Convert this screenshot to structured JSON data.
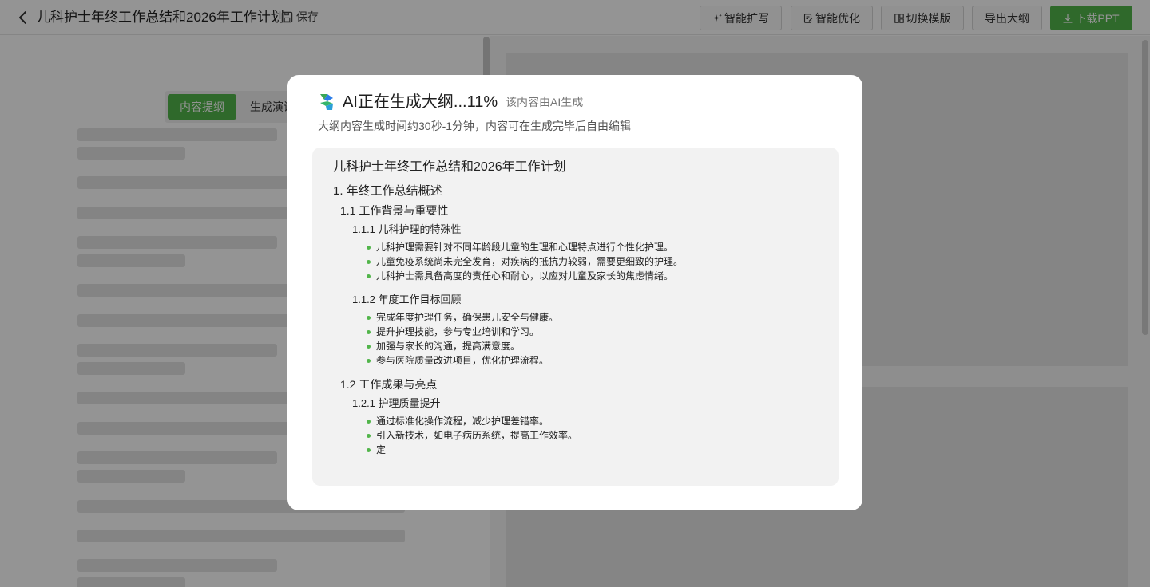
{
  "header": {
    "title": "儿科护士年终工作总结和2026年工作计划",
    "save_label": "保存",
    "buttons": {
      "expand": "智能扩写",
      "optimize": "智能优化",
      "switch_template": "切换模版",
      "export_outline": "导出大纲",
      "download_ppt": "下载PPT"
    }
  },
  "tabs": {
    "outline": "内容提纲",
    "speech": "生成演讲稿"
  },
  "modal": {
    "title": "AI正在生成大纲...11%",
    "ai_note": "该内容由AI生成",
    "subtitle": "大纲内容生成时间约30秒-1分钟，内容可在生成完毕后自由编辑",
    "progress_percent": 11
  },
  "outline": {
    "title": "儿科护士年终工作总结和2026年工作计划",
    "items": [
      {
        "level": 1,
        "text": "1. 年终工作总结概述"
      },
      {
        "level": 2,
        "text": "1.1 工作背景与重要性"
      },
      {
        "level": 3,
        "text": "1.1.1 儿科护理的特殊性"
      },
      {
        "level": 4,
        "text": "儿科护理需要针对不同年龄段儿童的生理和心理特点进行个性化护理。"
      },
      {
        "level": 4,
        "text": "儿童免疫系统尚未完全发育，对疾病的抵抗力较弱，需要更细致的护理。"
      },
      {
        "level": 4,
        "text": "儿科护士需具备高度的责任心和耐心，以应对儿童及家长的焦虑情绪。"
      },
      {
        "level": 3,
        "text": "1.1.2 年度工作目标回顾"
      },
      {
        "level": 4,
        "text": "完成年度护理任务，确保患儿安全与健康。"
      },
      {
        "level": 4,
        "text": "提升护理技能，参与专业培训和学习。"
      },
      {
        "level": 4,
        "text": "加强与家长的沟通，提高满意度。"
      },
      {
        "level": 4,
        "text": "参与医院质量改进项目，优化护理流程。"
      },
      {
        "level": 2,
        "text": "1.2 工作成果与亮点"
      },
      {
        "level": 3,
        "text": "1.2.1 护理质量提升"
      },
      {
        "level": 4,
        "text": "通过标准化操作流程，减少护理差错率。"
      },
      {
        "level": 4,
        "text": "引入新技术，如电子病历系统，提高工作效率。"
      },
      {
        "level": 4,
        "text": "定"
      }
    ]
  },
  "colors": {
    "accent": "#52b54b",
    "overlay": "rgba(0,0,0,0.42)"
  },
  "icons": [
    "back-arrow-icon",
    "save-icon",
    "sparkle-icon",
    "optimize-icon",
    "template-icon",
    "download-icon",
    "ai-logo-icon",
    "bullet-dot-icon"
  ]
}
